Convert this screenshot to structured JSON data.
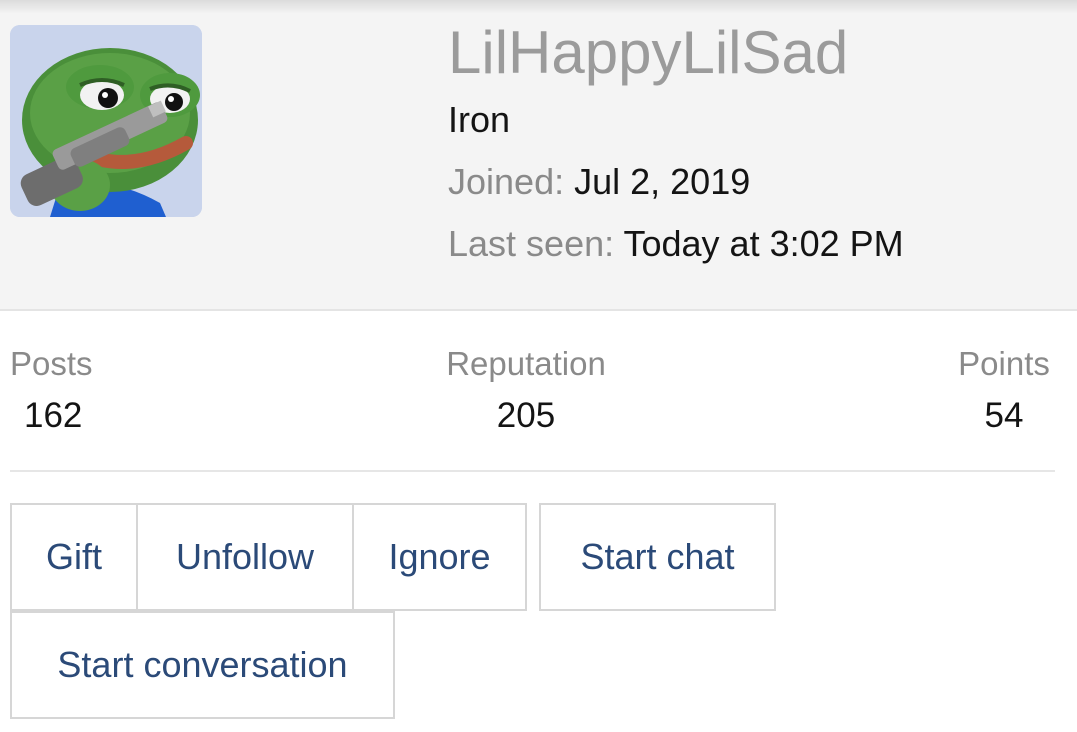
{
  "profile": {
    "username": "LilHappyLilSad",
    "title": "Iron",
    "joined_label": "Joined:",
    "joined_value": "Jul 2, 2019",
    "last_seen_label": "Last seen:",
    "last_seen_value": "Today at 3:02 PM",
    "avatar_icon": "pepe-frog-avatar"
  },
  "stats": [
    {
      "label": "Posts",
      "value": "162"
    },
    {
      "label": "Reputation",
      "value": "205"
    },
    {
      "label": "Points",
      "value": "54"
    }
  ],
  "actions": {
    "gift": "Gift",
    "unfollow": "Unfollow",
    "ignore": "Ignore",
    "start_chat": "Start chat",
    "start_conversation": "Start conversation"
  },
  "colors": {
    "link": "#2b4a78",
    "header_bg": "#f4f4f4",
    "muted": "#8a8a8a",
    "username": "#9b9b9b"
  }
}
